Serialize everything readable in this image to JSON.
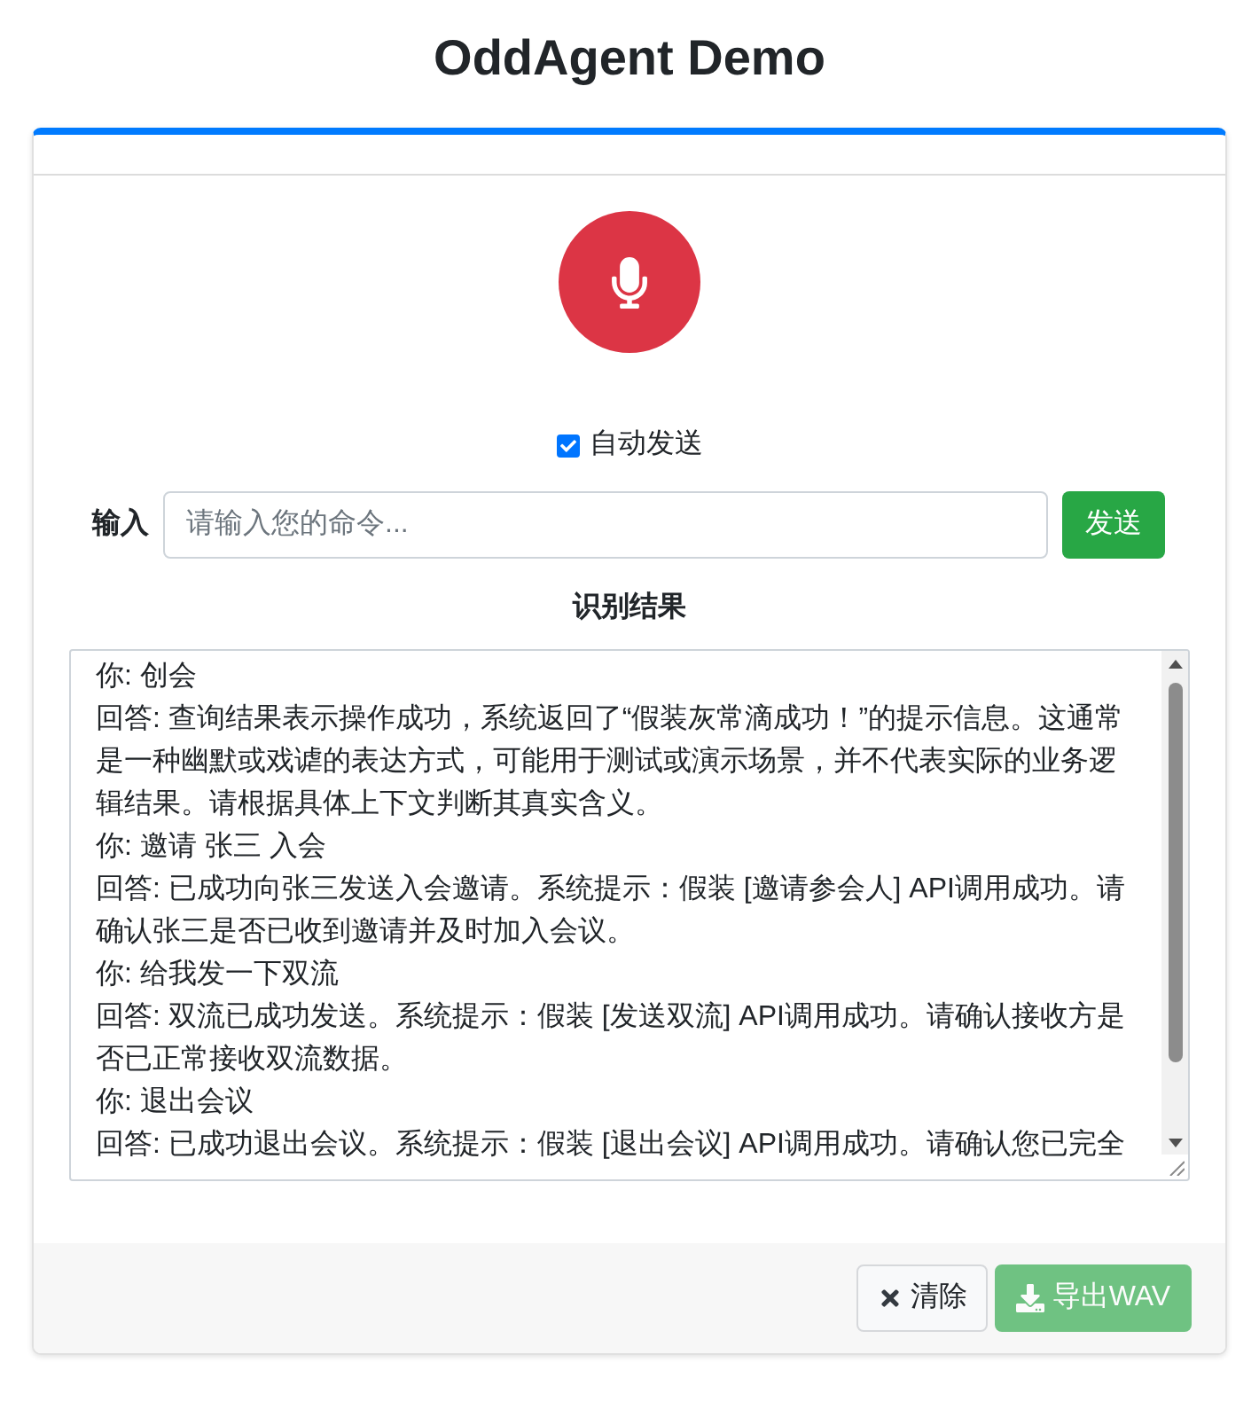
{
  "title": "OddAgent Demo",
  "auto_send": {
    "label": "自动发送",
    "checked": true
  },
  "command": {
    "label": "输入",
    "placeholder": "请输入您的命令...",
    "send_button": "发送"
  },
  "result": {
    "heading": "识别结果",
    "transcript": [
      "你: 创会",
      "回答: 查询结果表示操作成功，系统返回了“假装灰常滴成功！”的提示信息。这通常是一种幽默或戏谑的表达方式，可能用于测试或演示场景，并不代表实际的业务逻辑结果。请根据具体上下文判断其真实含义。",
      "你: 邀请 张三 入会",
      "回答: 已成功向张三发送入会邀请。系统提示：假装 [邀请参会人] API调用成功。请确认张三是否已收到邀请并及时加入会议。",
      "你: 给我发一下双流",
      "回答: 双流已成功发送。系统提示：假装 [发送双流] API调用成功。请确认接收方是否已正常接收双流数据。",
      "你: 退出会议",
      "回答: 已成功退出会议。系统提示：假装 [退出会议] API调用成功。请确认您已完全"
    ]
  },
  "footer": {
    "buttons": [
      {
        "kind": "clear",
        "label": "清除",
        "disabled": false
      },
      {
        "kind": "export",
        "label": "导出WAV",
        "disabled": true
      }
    ]
  }
}
